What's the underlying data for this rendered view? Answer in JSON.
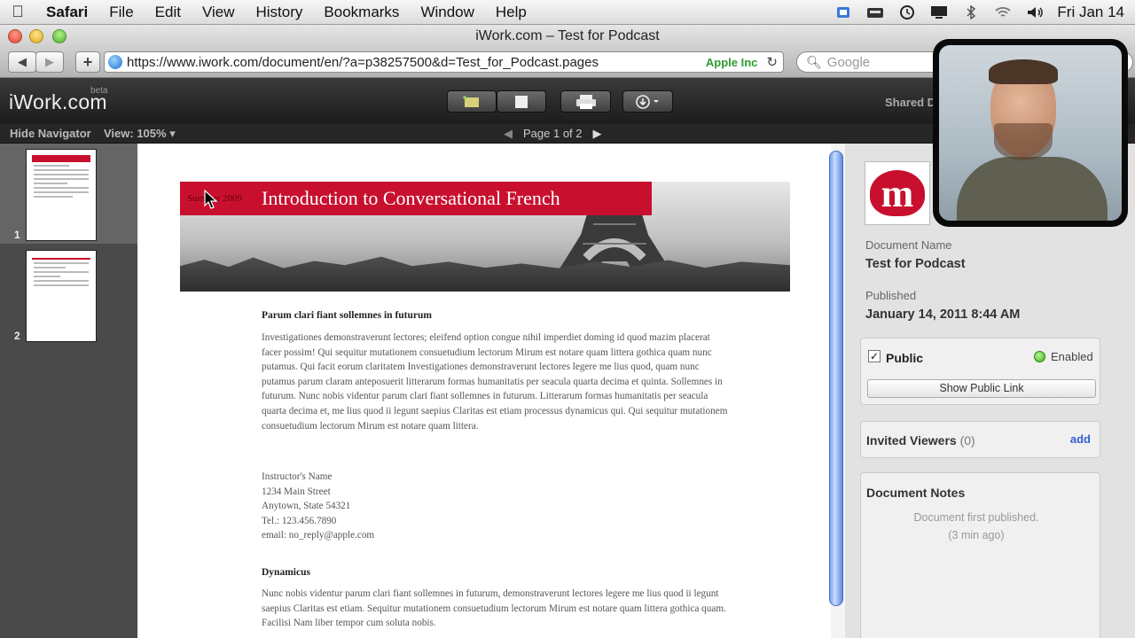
{
  "menubar": {
    "app": "Safari",
    "items": [
      "File",
      "Edit",
      "View",
      "History",
      "Bookmarks",
      "Window",
      "Help"
    ],
    "clock": "Fri Jan 14",
    "status_icons": [
      "spaces-icon",
      "inbox-icon",
      "time-machine-icon",
      "display-icon",
      "bluetooth-icon",
      "wifi-icon",
      "volume-icon"
    ]
  },
  "window": {
    "title": "iWork.com – Test for Podcast",
    "url": "https://www.iwork.com/document/en/?a=p38257500&d=Test_for_Podcast.pages",
    "cert_name": "Apple Inc",
    "search_placeholder": "Google"
  },
  "iwork": {
    "logo": "iWork.com",
    "beta": "beta",
    "shared_label": "Shared D",
    "hide_navigator": "Hide Navigator",
    "view_zoom": "View: 105% ▾",
    "page_indicator": "Page 1 of 2"
  },
  "navigator": {
    "pages": [
      {
        "num": "1",
        "selected": true
      },
      {
        "num": "2",
        "selected": false
      }
    ]
  },
  "document": {
    "banner_small": "Summer 2009",
    "banner_title": "Introduction to Conversational French",
    "heading1": "Parum clari fiant sollemnes in futurum",
    "para1": "Investigationes demonstraverunt lectores; eleifend option congue nihil imperdiet doming id quod mazim placerat facer possim! Qui sequitur mutationem consuetudium lectorum Mirum est notare quam littera gothica quam nunc putamus. Qui facit eorum claritatem Investigationes demonstraverunt lectores legere me lius quod, quam nunc putamus parum claram anteposuerit litterarum formas humanitatis per seacula quarta decima et quinta. Sollemnes in futurum. Nunc nobis videntur parum clari fiant sollemnes in futurum. Litterarum formas humanitatis per seacula quarta decima et, me lius quod ii legunt saepius Claritas est etiam processus dynamicus qui. Qui sequitur mutationem consuetudium lectorum Mirum est notare quam littera.",
    "address": [
      "Instructor's Name",
      "1234 Main Street",
      "Anytown, State 54321",
      "Tel.: 123.456.7890",
      "email: no_reply@apple.com"
    ],
    "heading2": "Dynamicus",
    "para2": "Nunc nobis videntur parum clari fiant sollemnes in futurum, demonstraverunt lectores legere me lius quod ii legunt saepius Claritas est etiam. Sequitur mutationem consuetudium lectorum Mirum est notare quam littera gothica quam. Facilisi Nam liber tempor cum soluta nobis."
  },
  "sidebar": {
    "doc_name_label": "Document Name",
    "doc_name": "Test for Podcast",
    "published_label": "Published",
    "published": "January 14, 2011 8:44 AM",
    "public_label": "Public",
    "public_checked": true,
    "enabled": "Enabled",
    "show_link": "Show Public Link",
    "invited_label": "Invited Viewers",
    "invited_count": "(0)",
    "add": "add",
    "notes_label": "Document Notes",
    "note_text": "Document first published.",
    "note_time": "(3 min ago)",
    "accent": "#c8102e"
  }
}
